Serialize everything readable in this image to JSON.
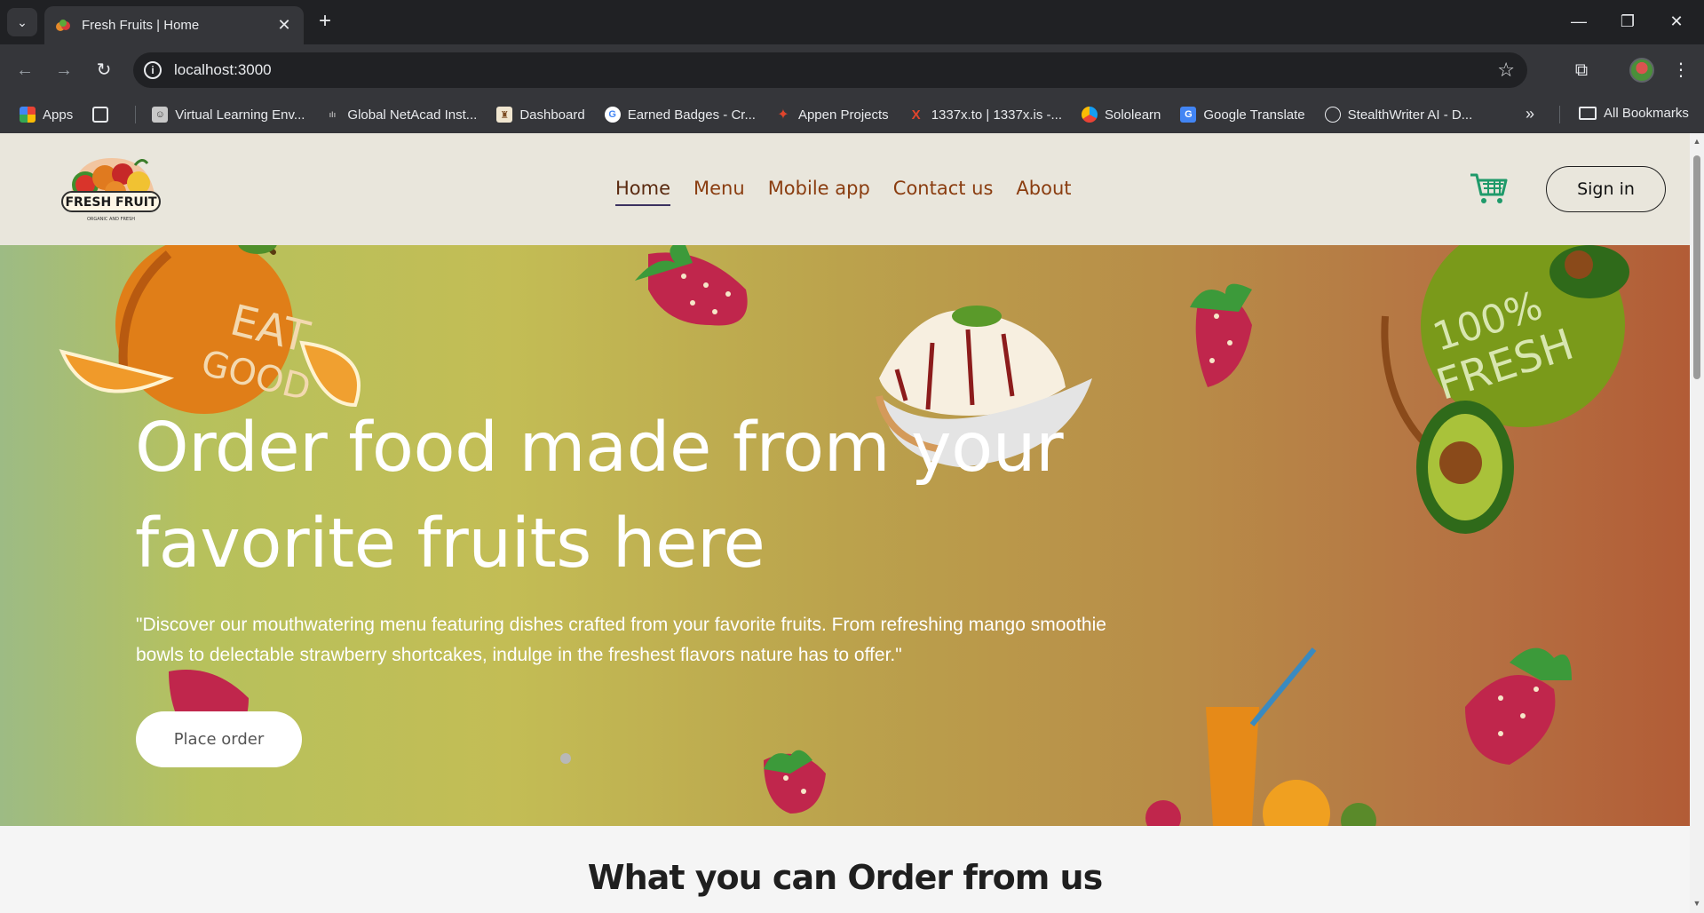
{
  "browser": {
    "tab_title": "Fresh Fruits | Home",
    "url": "localhost:3000",
    "bookmarks": [
      {
        "label": "Apps",
        "icon": "apps-grid-icon"
      },
      {
        "label": "Virtual Learning Env...",
        "icon": "robot-icon"
      },
      {
        "label": "Global NetAcad Inst...",
        "icon": "cisco-icon"
      },
      {
        "label": "Dashboard",
        "icon": "dashboard-icon"
      },
      {
        "label": "Earned Badges - Cr...",
        "icon": "google-icon"
      },
      {
        "label": "Appen Projects",
        "icon": "appen-icon"
      },
      {
        "label": "1337x.to | 1337x.is -...",
        "icon": "x-icon"
      },
      {
        "label": "Sololearn",
        "icon": "sololearn-icon"
      },
      {
        "label": "Google Translate",
        "icon": "google-translate-icon"
      },
      {
        "label": "StealthWriter AI - D...",
        "icon": "stealthwriter-icon"
      }
    ],
    "all_bookmarks": "All Bookmarks"
  },
  "site": {
    "logo_text": "FRESH FRUIT",
    "logo_tagline": "ORGANIC AND FRESH",
    "nav": [
      "Home",
      "Menu",
      "Mobile app",
      "Contact us",
      "About"
    ],
    "active_nav": "Home",
    "sign_in": "Sign in"
  },
  "hero": {
    "heading_line1": "Order food made from your",
    "heading_line2": "favorite fruits here",
    "description": "\"Discover our mouthwatering menu featuring dishes crafted from your favorite fruits. From refreshing mango smoothie bowls to delectable strawberry shortcakes, indulge in the freshest flavors nature has to offer.\"",
    "cta": "Place order",
    "badge_left_1": "EAT",
    "badge_left_2": "GOOD",
    "badge_right_1": "100%",
    "badge_right_2": "FRESH"
  },
  "section": {
    "title": "What you can Order from us"
  },
  "colors": {
    "header_bg": "#e9e6dc",
    "nav_text": "#8a3d10",
    "cart": "#1f9a6a",
    "page_bg": "#f5f5f5"
  }
}
